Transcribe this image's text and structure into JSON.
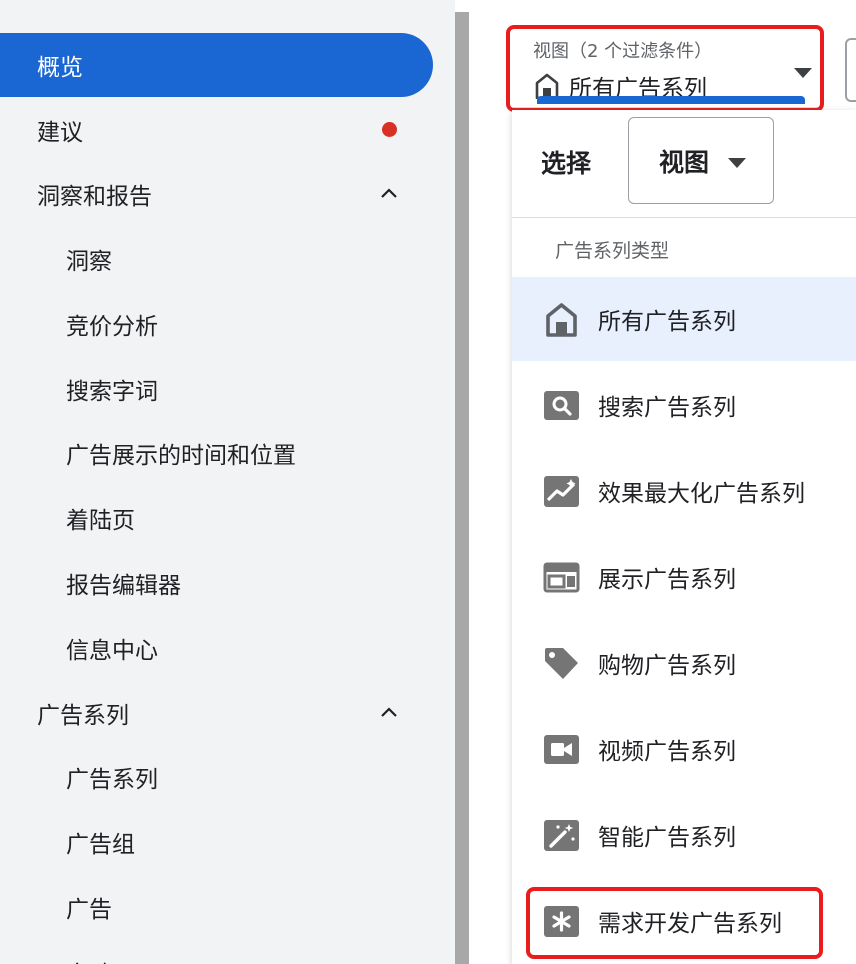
{
  "sidebar": {
    "items": [
      {
        "label": "概览"
      },
      {
        "label": "建议"
      },
      {
        "label": "洞察和报告"
      },
      {
        "label": "洞察"
      },
      {
        "label": "竞价分析"
      },
      {
        "label": "搜索字词"
      },
      {
        "label": "广告展示的时间和位置"
      },
      {
        "label": "着陆页"
      },
      {
        "label": "报告编辑器"
      },
      {
        "label": "信息中心"
      },
      {
        "label": "广告系列"
      },
      {
        "label": "广告系列"
      },
      {
        "label": "广告组"
      },
      {
        "label": "广告"
      },
      {
        "label": "实验"
      }
    ]
  },
  "view_selector": {
    "caption": "视图（2 个过滤条件）",
    "value": "所有广告系列"
  },
  "dropdown": {
    "select_label": "选择",
    "select_value": "视图",
    "section_title": "广告系列类型",
    "items": [
      {
        "label": "所有广告系列",
        "icon": "home-icon",
        "selected": true
      },
      {
        "label": "搜索广告系列",
        "icon": "search-icon"
      },
      {
        "label": "效果最大化广告系列",
        "icon": "trending-up-icon"
      },
      {
        "label": "展示广告系列",
        "icon": "display-layout-icon"
      },
      {
        "label": "购物广告系列",
        "icon": "tag-icon"
      },
      {
        "label": "视频广告系列",
        "icon": "video-camera-icon"
      },
      {
        "label": "智能广告系列",
        "icon": "magic-wand-icon"
      },
      {
        "label": "需求开发广告系列",
        "icon": "asterisk-icon"
      }
    ]
  },
  "colors": {
    "accent": "#1a66d2",
    "highlight_box": "#ea1d1d",
    "notification_dot": "#d93025",
    "selected_row": "#e8f0fe"
  }
}
